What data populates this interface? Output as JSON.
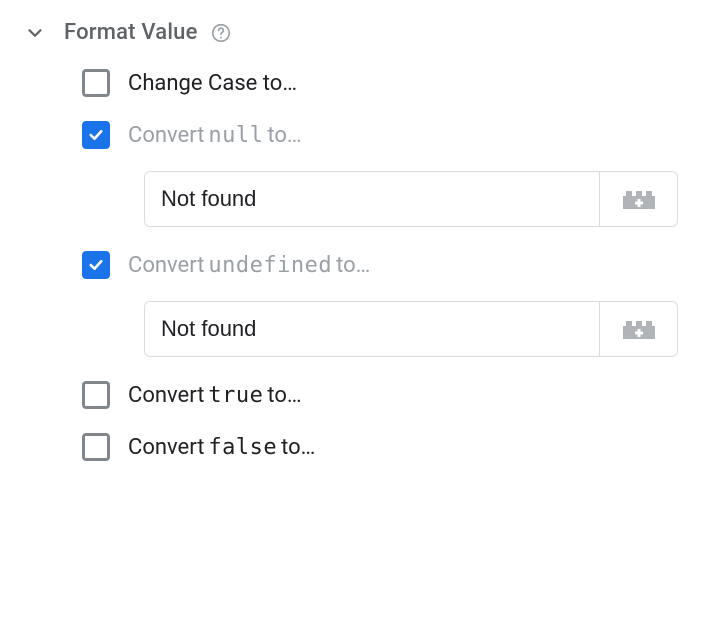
{
  "section": {
    "title": "Format Value"
  },
  "options": {
    "changeCase": {
      "prefix": "Change Case to…",
      "code": "",
      "suffix": "",
      "checked": false
    },
    "convertNull": {
      "prefix": "Convert ",
      "code": "null",
      "suffix": " to…",
      "checked": true,
      "value": "Not found"
    },
    "convertUndef": {
      "prefix": "Convert ",
      "code": "undefined",
      "suffix": " to…",
      "checked": true,
      "value": "Not found"
    },
    "convertTrue": {
      "prefix": "Convert ",
      "code": "true",
      "suffix": " to…",
      "checked": false
    },
    "convertFalse": {
      "prefix": "Convert ",
      "code": "false",
      "suffix": " to…",
      "checked": false
    }
  }
}
